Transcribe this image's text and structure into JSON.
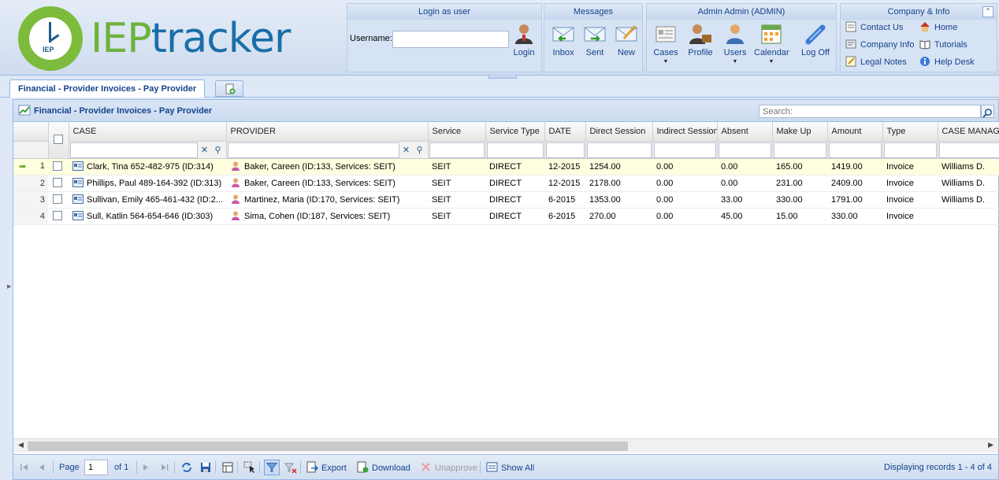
{
  "logo": {
    "small_text": "IEP",
    "brand_iep": "IEP",
    "brand_rest": "tracker"
  },
  "login_panel": {
    "title": "Login as user",
    "username_label": "Username:",
    "username_value": "",
    "login_label": "Login"
  },
  "messages_panel": {
    "title": "Messages",
    "items": [
      {
        "label": "Inbox",
        "icon": "inbox-icon"
      },
      {
        "label": "Sent",
        "icon": "sent-icon"
      },
      {
        "label": "New",
        "icon": "new-message-icon"
      }
    ]
  },
  "admin_panel": {
    "title": "Admin Admin (ADMIN)",
    "items": [
      {
        "label": "Cases",
        "icon": "cases-icon",
        "dropdown": true
      },
      {
        "label": "Profile",
        "icon": "profile-icon",
        "dropdown": false
      },
      {
        "label": "Users",
        "icon": "users-icon",
        "dropdown": true
      },
      {
        "label": "Calendar",
        "icon": "calendar-icon",
        "dropdown": true
      },
      {
        "label": "Log Off",
        "icon": "log-off-icon",
        "dropdown": false
      }
    ]
  },
  "company_panel": {
    "title": "Company & Info",
    "links": [
      {
        "label": "Contact Us",
        "icon": "contact-icon"
      },
      {
        "label": "Home",
        "icon": "home-icon"
      },
      {
        "label": "Company Info",
        "icon": "company-info-icon"
      },
      {
        "label": "Tutorials",
        "icon": "tutorials-icon"
      },
      {
        "label": "Legal Notes",
        "icon": "legal-notes-icon"
      },
      {
        "label": "Help Desk",
        "icon": "help-desk-icon"
      }
    ]
  },
  "tabs": {
    "active": "Financial - Provider Invoices - Pay Provider"
  },
  "grid_panel": {
    "title": "Financial - Provider Invoices - Pay Provider",
    "search_placeholder": "Search:",
    "columns": [
      "CASE",
      "PROVIDER",
      "Service",
      "Service Type",
      "DATE",
      "Direct Session",
      "Indirect Session",
      "Absent",
      "Make Up",
      "Amount",
      "Type",
      "CASE MANAGER"
    ],
    "rows": [
      {
        "num": "1",
        "case": "Clark, Tina 652-482-975 (ID:314)",
        "provider": "Baker, Careen (ID:133, Services: SEIT)",
        "service": "SEIT",
        "service_type": "DIRECT",
        "date": "12-2015",
        "direct": "1254.00",
        "indirect": "0.00",
        "absent": "0.00",
        "makeup": "165.00",
        "amount": "1419.00",
        "type": "Invoice",
        "manager": "Williams D."
      },
      {
        "num": "2",
        "case": "Phillips, Paul 489-164-392 (ID:313)",
        "provider": "Baker, Careen (ID:133, Services: SEIT)",
        "service": "SEIT",
        "service_type": "DIRECT",
        "date": "12-2015",
        "direct": "2178.00",
        "indirect": "0.00",
        "absent": "0.00",
        "makeup": "231.00",
        "amount": "2409.00",
        "type": "Invoice",
        "manager": "Williams D."
      },
      {
        "num": "3",
        "case": "Sullivan, Emily 465-461-432 (ID:2...",
        "provider": "Martinez, Maria (ID:170, Services: SEIT)",
        "service": "SEIT",
        "service_type": "DIRECT",
        "date": "6-2015",
        "direct": "1353.00",
        "indirect": "0.00",
        "absent": "33.00",
        "makeup": "330.00",
        "amount": "1791.00",
        "type": "Invoice",
        "manager": "Williams D."
      },
      {
        "num": "4",
        "case": "Sull, Katlin 564-654-646 (ID:303)",
        "provider": "Sima, Cohen (ID:187, Services: SEIT)",
        "service": "SEIT",
        "service_type": "DIRECT",
        "date": "6-2015",
        "direct": "270.00",
        "indirect": "0.00",
        "absent": "45.00",
        "makeup": "15.00",
        "amount": "330.00",
        "type": "Invoice",
        "manager": ""
      }
    ]
  },
  "pager": {
    "page_label": "Page",
    "page_value": "1",
    "of_label": "of 1",
    "export": "Export",
    "download": "Download",
    "unapprove": "Unapprove",
    "show_all": "Show All",
    "display_text": "Displaying records 1 - 4 of 4"
  }
}
